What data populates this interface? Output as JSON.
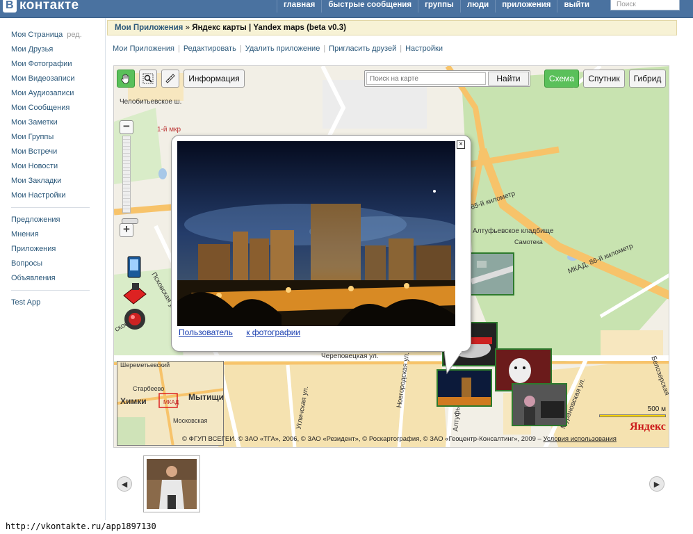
{
  "header": {
    "logo_text": "контакте",
    "logo_mark": "В",
    "nav": [
      "главная",
      "быстрые сообщения",
      "группы",
      "люди",
      "приложения",
      "выйти"
    ],
    "search_placeholder": "Поиск"
  },
  "sidebar": {
    "edit_label": "ред.",
    "group1": [
      "Моя Страница",
      "Мои Друзья",
      "Мои Фотографии",
      "Мои Видеозаписи",
      "Мои Аудиозаписи",
      "Мои Сообщения",
      "Мои Заметки",
      "Мои Группы",
      "Мои Встречи",
      "Мои Новости",
      "Мои Закладки",
      "Мои Настройки"
    ],
    "group2": [
      "Предложения",
      "Мнения",
      "Приложения",
      "Вопросы",
      "Объявления"
    ],
    "group3": [
      "Test App"
    ]
  },
  "titlebar": {
    "crumb": "Мои Приложения",
    "arrow": "»",
    "title": "Яндекс карты | Yandex maps (beta v0.3)"
  },
  "subnav": [
    "Мои Приложения",
    "Редактировать",
    "Удалить приложение",
    "Пригласить друзей",
    "Настройки"
  ],
  "map": {
    "info_button": "Информация",
    "search_placeholder": "Поиск на карте",
    "search_button": "Найти",
    "layers": [
      "Схема",
      "Спутник",
      "Гибрид"
    ],
    "active_layer": "Схема",
    "streets": [
      "Челобитьевское ш.",
      "1-й мкр",
      "Псковская ул.",
      "85-й километр",
      "Алтуфьевское кладбище",
      "Самотека",
      "МКАД, 86-й километр",
      "Череповецкая ул.",
      "Угличская ул.",
      "Новгородская ул.",
      "Мурановская ул.",
      "Белозерская",
      "Шереметьевский",
      "Старбеево",
      "Химки",
      "Мытищи",
      "Московская",
      "МКАД",
      "Алтуфьевское ш.",
      "ское ш."
    ],
    "scale_label": "500 м",
    "yandex_logo": "Яндекс",
    "copyright": "© ФГУП ВСЕГЕИ. © ЗАО «ТГА», 2006, © ЗАО «Резидент», © Роскартография, © ЗАО «Геоцентр-Консалтинг», 2009 –",
    "terms_link": "Условия использования"
  },
  "popup": {
    "link_user": "Пользователь",
    "link_photo": "к фотографии",
    "close": "×"
  },
  "status_url": "http://vkontakte.ru/app1897130",
  "colors": {
    "header": "#4a72a0",
    "link": "#2b587a",
    "green_button": "#5ac05a",
    "thumb_border": "#2d7a2d",
    "park": "#c8e3b0",
    "road_major": "#f7c36a"
  }
}
